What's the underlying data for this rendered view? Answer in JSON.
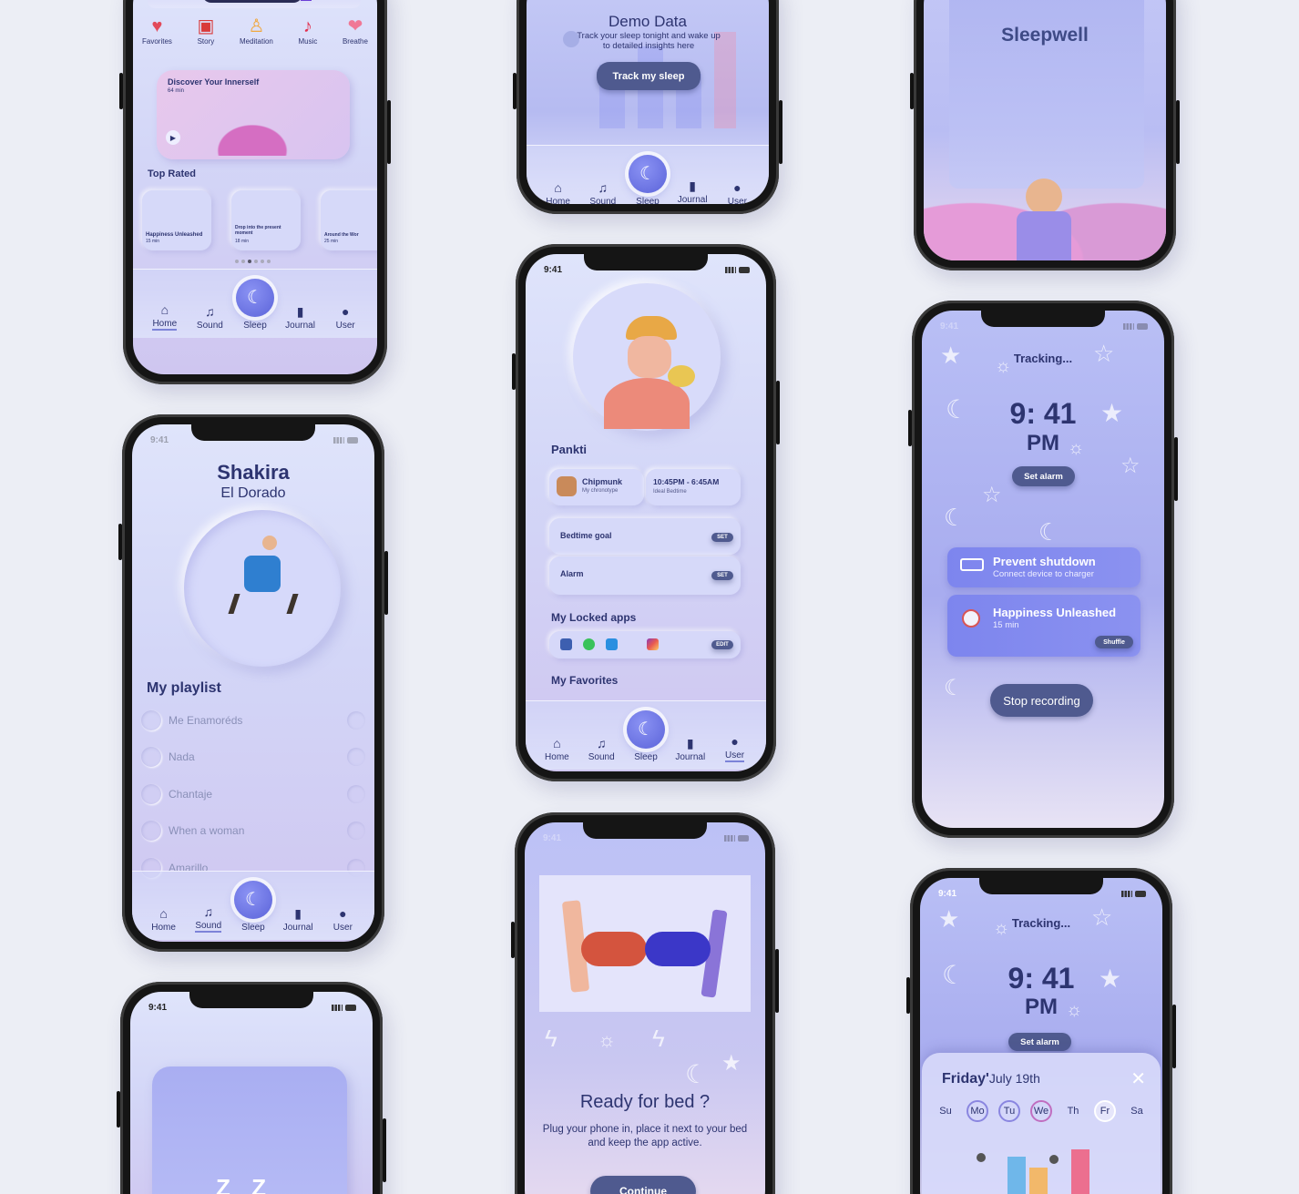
{
  "status_time": "9:41",
  "nav": {
    "home": "Home",
    "sound": "Sound",
    "sleep": "Sleep",
    "journal": "Journal",
    "user": "User"
  },
  "p1": {
    "categories": [
      "Favorites",
      "Story",
      "Meditation",
      "Music",
      "Breathe"
    ],
    "feature_title": "Discover Your Innerself",
    "feature_duration": "64 min",
    "top_rated": "Top Rated",
    "cards": [
      {
        "title": "Happiness Unleashed",
        "duration": "15 min"
      },
      {
        "title": "Drop into the present moment",
        "duration": "18 min"
      },
      {
        "title": "Around the Wor",
        "duration": "25 min"
      }
    ]
  },
  "p2": {
    "title": "Demo Data",
    "subtitle": "Track your sleep tonight and wake up to detailed insights here",
    "button": "Track my sleep"
  },
  "p3": {
    "title": "Sleepwell"
  },
  "p4": {
    "artist": "Shakira",
    "album": "El Dorado",
    "playlist_title": "My playlist",
    "songs": [
      "Me Enamoréds",
      "Nada",
      "Chantaje",
      "When a woman",
      "Amarillo"
    ]
  },
  "p5": {
    "name": "Pankti",
    "chronotype_name": "Chipmunk",
    "chronotype_label": "My chronotype",
    "bedtime_range": "10:45PM - 6:45AM",
    "bedtime_label": "Ideal Bedtime",
    "bedtime_goal": "Bedtime goal",
    "alarm": "Alarm",
    "set": "SET",
    "locked_title": "My Locked apps",
    "edit": "EDIT",
    "favorites_title": "My Favorites"
  },
  "p6": {
    "tracking": "Tracking...",
    "time": "9: 41",
    "ampm": "PM",
    "set_alarm": "Set alarm",
    "prevent_title": "Prevent shutdown",
    "prevent_sub": "Connect device to charger",
    "song_title": "Happiness Unleashed",
    "song_duration": "15 min",
    "shuffle": "Shuffle",
    "stop": "Stop recording"
  },
  "p7": {
    "title": "Ready for bed ?",
    "body": "Plug your phone in, place it next to your bed and keep the app active.",
    "continue": "Continue"
  },
  "p8": {
    "tracking": "Tracking...",
    "time": "9: 41",
    "ampm": "PM",
    "set_alarm": "Set alarm",
    "day": "Friday'",
    "date": "July 19th",
    "weekdays": [
      "Su",
      "Mo",
      "Tu",
      "We",
      "Th",
      "Fr",
      "Sa"
    ]
  },
  "p9": {
    "zz": "Z Z"
  },
  "colors": {
    "accent": "#6a72e3",
    "dark_button": "#4f5a8f",
    "text": "#2d3470"
  }
}
